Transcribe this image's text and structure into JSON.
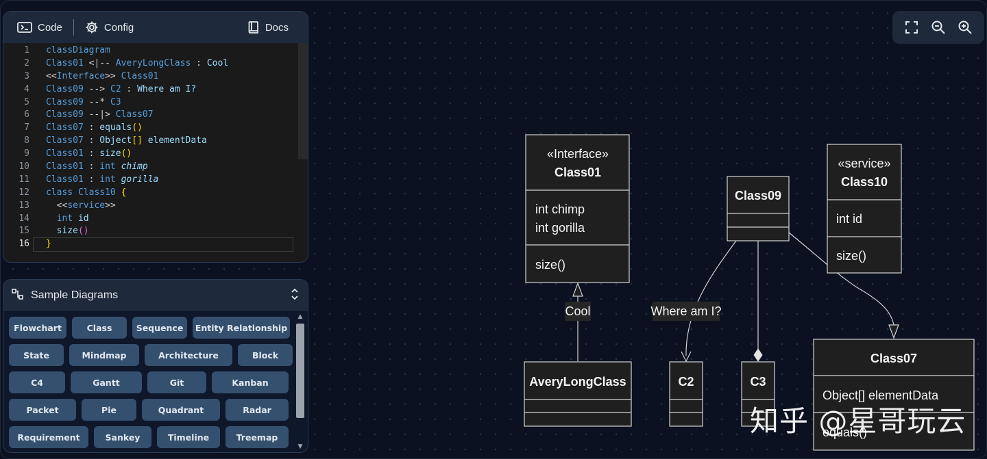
{
  "editor": {
    "tabs": {
      "code": "Code",
      "config": "Config",
      "docs": "Docs"
    },
    "lines": [
      {
        "n": "1",
        "html": "<span class='k'>classDiagram</span>"
      },
      {
        "n": "2",
        "html": "<span class='k'>Class01</span> <span class='t'>&lt;|--</span> <span class='k'>AveryLongClass</span> <span class='t'>:</span> Cool"
      },
      {
        "n": "3",
        "html": "<span class='t'>&lt;&lt;</span><span class='k'>Interface</span><span class='t'>&gt;&gt;</span> <span class='k'>Class01</span>"
      },
      {
        "n": "4",
        "html": "<span class='k'>Class09</span> <span class='t'>--&gt;</span> <span class='k'>C2</span> <span class='t'>:</span> Where am I?"
      },
      {
        "n": "5",
        "html": "<span class='k'>Class09</span> <span class='t'>--*</span> <span class='k'>C3</span>"
      },
      {
        "n": "6",
        "html": "<span class='k'>Class09</span> <span class='t'>--|&gt;</span> <span class='k'>Class07</span>"
      },
      {
        "n": "7",
        "html": "<span class='k'>Class07</span> <span class='t'>:</span> equals<span class='p'>()</span>"
      },
      {
        "n": "8",
        "html": "<span class='k'>Class07</span> <span class='t'>:</span> Object<span class='p'>[]</span> elementData"
      },
      {
        "n": "9",
        "html": "<span class='k'>Class01</span> <span class='t'>:</span> size<span class='p'>()</span>"
      },
      {
        "n": "10",
        "html": "<span class='k'>Class01</span> <span class='t'>:</span> <span class='k'>int</span> <span class='it'>chimp</span>"
      },
      {
        "n": "11",
        "html": "<span class='k'>Class01</span> <span class='t'>:</span> <span class='k'>int</span> <span class='it'>gorilla</span>"
      },
      {
        "n": "12",
        "html": "<span class='k'>class</span> <span class='k'>Class10</span> <span class='p'>{</span>"
      },
      {
        "n": "13",
        "html": "  <span class='t'>&lt;&lt;</span><span class='k'>service</span><span class='t'>&gt;&gt;</span>"
      },
      {
        "n": "14",
        "html": "  <span class='k'>int</span> id"
      },
      {
        "n": "15",
        "html": "  size<span class='pk'>()</span>"
      },
      {
        "n": "16",
        "html": "<span class='p'>}</span>"
      }
    ]
  },
  "samples": {
    "title": "Sample Diagrams",
    "rows": [
      [
        "Flowchart",
        "Class",
        "Sequence",
        "Entity Relationship"
      ],
      [
        "State",
        "Mindmap",
        "Architecture",
        "Block"
      ],
      [
        "C4",
        "Gantt",
        "Git",
        "Kanban"
      ],
      [
        "Packet",
        "Pie",
        "Quadrant",
        "Radar"
      ],
      [
        "Requirement",
        "Sankey",
        "Timeline",
        "Treemap"
      ]
    ]
  },
  "zoom": [
    "fullscreen-icon",
    "zoom-out-icon",
    "zoom-in-icon"
  ],
  "diagram": {
    "class01": {
      "stereotype": "«Interface»",
      "name": "Class01",
      "attrs": [
        "int chimp",
        "int gorilla"
      ],
      "methods": [
        "size()"
      ]
    },
    "class09": {
      "name": "Class09"
    },
    "class10": {
      "stereotype": "«service»",
      "name": "Class10",
      "attrs": [
        "int id"
      ],
      "methods": [
        "size()"
      ]
    },
    "averylong": {
      "name": "AveryLongClass"
    },
    "c2": {
      "name": "C2"
    },
    "c3": {
      "name": "C3"
    },
    "class07": {
      "name": "Class07",
      "attrs": [
        "Object[] elementData"
      ],
      "methods": [
        "equals()"
      ]
    },
    "labels": {
      "cool": "Cool",
      "where": "Where am I?"
    }
  },
  "watermark": "知乎 @星哥玩云",
  "colors": {
    "background": "#0b1120",
    "panel": "#1e293b",
    "button": "#35506f",
    "node_fill": "#1f1f1f",
    "node_stroke": "#d4d4d4"
  }
}
